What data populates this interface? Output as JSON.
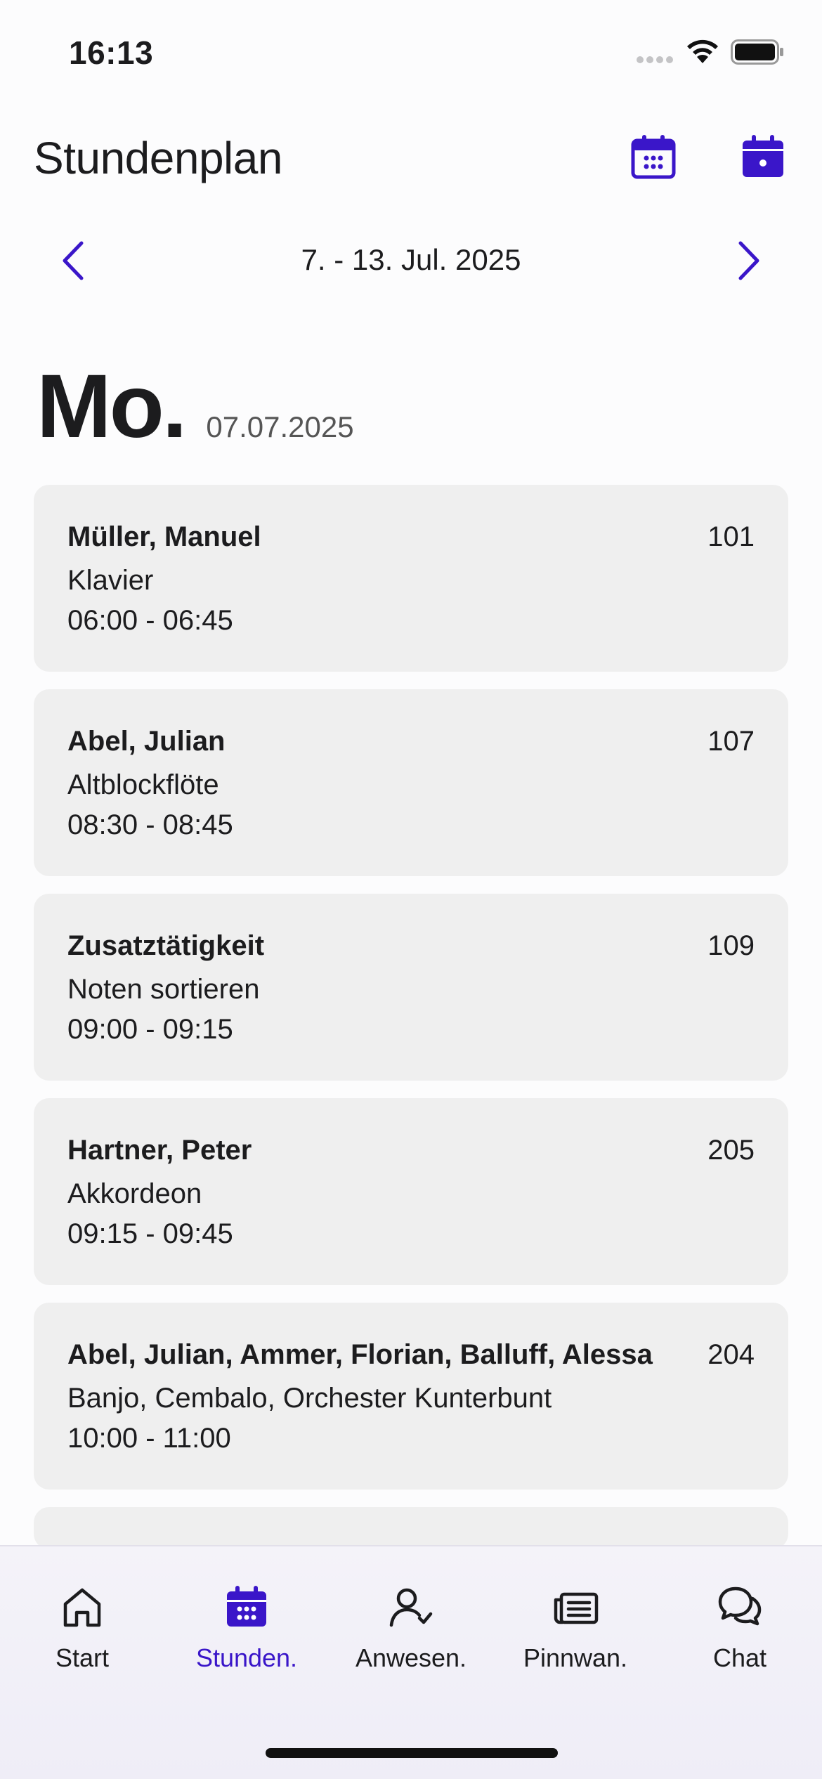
{
  "status_bar": {
    "time": "16:13"
  },
  "header": {
    "title": "Stundenplan",
    "week_view_icon": "calendar-week-icon",
    "day_view_icon": "calendar-day-icon"
  },
  "week_nav": {
    "range": "7. - 13. Jul. 2025",
    "prev_icon": "chevron-left-icon",
    "next_icon": "chevron-right-icon"
  },
  "day": {
    "name": "Mo.",
    "date": "07.07.2025"
  },
  "lessons": [
    {
      "name": "Müller, Manuel",
      "room": "101",
      "subject": "Klavier",
      "time": "06:00 - 06:45"
    },
    {
      "name": "Abel, Julian",
      "room": "107",
      "subject": "Altblockflöte",
      "time": "08:30 - 08:45"
    },
    {
      "name": "Zusatztätigkeit",
      "room": "109",
      "subject": "Noten sortieren",
      "time": "09:00 - 09:15"
    },
    {
      "name": "Hartner, Peter",
      "room": "205",
      "subject": "Akkordeon",
      "time": "09:15 - 09:45"
    },
    {
      "name": "Abel, Julian, Ammer, Florian, Balluff, Alessa",
      "room": "204",
      "subject": "Banjo, Cembalo, Orchester Kunterbunt",
      "time": "10:00 - 11:00"
    }
  ],
  "tabs": [
    {
      "label": "Start",
      "icon": "home-icon",
      "active": false
    },
    {
      "label": "Stunden.",
      "icon": "calendar-icon",
      "active": true
    },
    {
      "label": "Anwesen.",
      "icon": "user-check-icon",
      "active": false
    },
    {
      "label": "Pinnwan.",
      "icon": "newspaper-icon",
      "active": false
    },
    {
      "label": "Chat",
      "icon": "chat-bubbles-icon",
      "active": false
    }
  ],
  "colors": {
    "accent": "#3a16c9",
    "card_bg": "#efefef",
    "background": "#fcfcfd"
  }
}
